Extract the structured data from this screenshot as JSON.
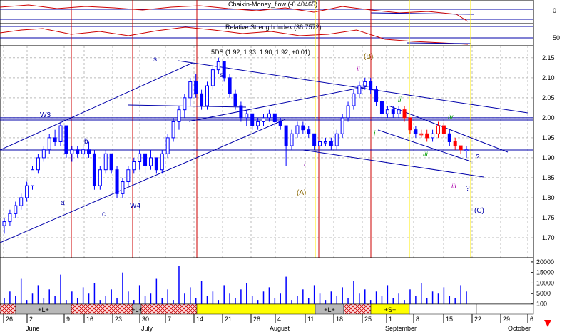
{
  "indicators": {
    "chaikin_label": "Chaikin-Money_flow (-0.40465)",
    "chaikin_scale": "0",
    "rsi_label": "Relative Strength Index (38.7572)",
    "rsi_scale": "50"
  },
  "price_header": "5DS (1.92, 1.93, 1.90, 1.92, +0.01)",
  "colors": {
    "bull": "#0000ff",
    "bear": "#ff0000",
    "trend": "#0000aa",
    "cycle_red": "#cc0000",
    "cycle_yellow": "#ffee00",
    "grid": "#bbbbbb"
  },
  "chart_data": {
    "type": "candlestick",
    "ylim": [
      1.65,
      2.18
    ],
    "price_ticks": [
      "2.15",
      "2.10",
      "2.05",
      "2.00",
      "1.95",
      "1.90",
      "1.85",
      "1.80",
      "1.75",
      "1.70"
    ],
    "volume_ticks": [
      "20000",
      "15000",
      "10000",
      "5000",
      "100"
    ],
    "date_ticks": [
      "26",
      "2",
      "9",
      "16",
      "23",
      "30",
      "7",
      "14",
      "21",
      "28",
      "4",
      "11",
      "18",
      "25",
      "1",
      "8",
      "15",
      "22",
      "29",
      "6"
    ],
    "month_labels": [
      "June",
      "July",
      "August",
      "September",
      "October"
    ],
    "cycle_segments": [
      {
        "label": "",
        "kind": "red"
      },
      {
        "label": "+L+",
        "kind": "grey"
      },
      {
        "label": "",
        "kind": "red"
      },
      {
        "label": "+L+",
        "kind": "grey"
      },
      {
        "label": "",
        "kind": "red"
      },
      {
        "label": "",
        "kind": "yellow"
      },
      {
        "label": "+L+",
        "kind": "grey"
      },
      {
        "label": "",
        "kind": "red"
      },
      {
        "label": "+S+",
        "kind": "yellow"
      },
      {
        "label": "",
        "kind": "white"
      }
    ],
    "wave_labels": [
      "W3",
      "b",
      "a",
      "c",
      "W4",
      "s",
      "s",
      "i",
      "(A)",
      "ii",
      "(B)",
      "i",
      "ii",
      "iii",
      "iv",
      "iii",
      "?",
      "?",
      "(C)"
    ],
    "candles": [
      [
        1.73,
        1.75,
        1.71,
        1.74
      ],
      [
        1.74,
        1.77,
        1.73,
        1.76
      ],
      [
        1.76,
        1.79,
        1.75,
        1.78
      ],
      [
        1.78,
        1.81,
        1.77,
        1.8
      ],
      [
        1.8,
        1.84,
        1.79,
        1.83
      ],
      [
        1.83,
        1.88,
        1.82,
        1.87
      ],
      [
        1.87,
        1.91,
        1.86,
        1.9
      ],
      [
        1.9,
        1.93,
        1.89,
        1.92
      ],
      [
        1.92,
        1.96,
        1.91,
        1.95
      ],
      [
        1.95,
        1.97,
        1.93,
        1.94
      ],
      [
        1.94,
        1.99,
        1.93,
        1.98
      ],
      [
        1.98,
        1.96,
        1.9,
        1.91
      ],
      [
        1.91,
        1.93,
        1.89,
        1.92
      ],
      [
        1.92,
        1.93,
        1.9,
        1.91
      ],
      [
        1.91,
        1.93,
        1.9,
        1.92
      ],
      [
        1.92,
        1.94,
        1.9,
        1.91
      ],
      [
        1.91,
        1.92,
        1.82,
        1.83
      ],
      [
        1.83,
        1.88,
        1.82,
        1.87
      ],
      [
        1.87,
        1.92,
        1.86,
        1.91
      ],
      [
        1.91,
        1.91,
        1.86,
        1.87
      ],
      [
        1.87,
        1.88,
        1.8,
        1.81
      ],
      [
        1.81,
        1.85,
        1.8,
        1.84
      ],
      [
        1.84,
        1.88,
        1.83,
        1.87
      ],
      [
        1.87,
        1.9,
        1.86,
        1.89
      ],
      [
        1.89,
        1.92,
        1.87,
        1.91
      ],
      [
        1.91,
        1.9,
        1.86,
        1.88
      ],
      [
        1.88,
        1.92,
        1.87,
        1.9
      ],
      [
        1.9,
        1.9,
        1.86,
        1.87
      ],
      [
        1.87,
        1.92,
        1.86,
        1.91
      ],
      [
        1.91,
        1.96,
        1.9,
        1.95
      ],
      [
        1.95,
        2.0,
        1.94,
        1.99
      ],
      [
        1.99,
        2.03,
        1.97,
        2.02
      ],
      [
        2.02,
        2.06,
        2.0,
        2.05
      ],
      [
        2.05,
        2.1,
        2.03,
        2.09
      ],
      [
        2.09,
        2.11,
        2.05,
        2.06
      ],
      [
        2.06,
        2.07,
        2.02,
        2.03
      ],
      [
        2.03,
        2.09,
        2.02,
        2.08
      ],
      [
        2.08,
        2.13,
        2.07,
        2.12
      ],
      [
        2.12,
        2.15,
        2.11,
        2.14
      ],
      [
        2.14,
        2.13,
        2.09,
        2.1
      ],
      [
        2.1,
        2.11,
        2.05,
        2.06
      ],
      [
        2.06,
        2.07,
        2.02,
        2.03
      ],
      [
        2.03,
        2.04,
        1.99,
        2.0
      ],
      [
        2.0,
        2.02,
        1.98,
        2.01
      ],
      [
        2.01,
        2.0,
        1.97,
        1.98
      ],
      [
        1.98,
        2.0,
        1.97,
        1.99
      ],
      [
        1.99,
        2.01,
        1.98,
        2.0
      ],
      [
        2.0,
        2.02,
        1.99,
        2.01
      ],
      [
        2.01,
        2.0,
        1.98,
        1.99
      ],
      [
        1.99,
        2.0,
        1.97,
        1.98
      ],
      [
        1.98,
        1.96,
        1.88,
        1.93
      ],
      [
        1.93,
        1.97,
        1.92,
        1.96
      ],
      [
        1.96,
        1.99,
        1.95,
        1.98
      ],
      [
        1.98,
        1.99,
        1.96,
        1.97
      ],
      [
        1.97,
        1.98,
        1.95,
        1.96
      ],
      [
        1.96,
        1.95,
        1.92,
        1.93
      ],
      [
        1.93,
        1.95,
        1.92,
        1.94
      ],
      [
        1.94,
        1.95,
        1.93,
        1.94
      ],
      [
        1.94,
        1.95,
        1.92,
        1.93
      ],
      [
        1.93,
        1.97,
        1.92,
        1.96
      ],
      [
        1.96,
        2.01,
        1.95,
        2.0
      ],
      [
        2.0,
        2.04,
        1.99,
        2.03
      ],
      [
        2.03,
        2.07,
        2.02,
        2.06
      ],
      [
        2.06,
        2.09,
        2.05,
        2.08
      ],
      [
        2.08,
        2.1,
        2.07,
        2.09
      ],
      [
        2.09,
        2.1,
        2.06,
        2.07
      ],
      [
        2.07,
        2.08,
        2.03,
        2.04
      ],
      [
        2.04,
        2.05,
        2.0,
        2.01
      ],
      [
        2.01,
        2.03,
        2.0,
        2.02
      ],
      [
        2.02,
        2.03,
        2.0,
        2.01
      ],
      [
        2.01,
        2.03,
        2.0,
        2.02
      ],
      [
        2.02,
        2.03,
        1.99,
        2.0
      ],
      [
        2.0,
        2.0,
        1.96,
        1.97
      ],
      [
        1.97,
        1.98,
        1.95,
        1.96
      ],
      [
        1.96,
        1.97,
        1.95,
        1.96
      ],
      [
        1.96,
        1.97,
        1.94,
        1.95
      ],
      [
        1.95,
        1.97,
        1.94,
        1.96
      ],
      [
        1.96,
        1.99,
        1.95,
        1.98
      ],
      [
        1.98,
        1.99,
        1.95,
        1.96
      ],
      [
        1.96,
        1.97,
        1.93,
        1.94
      ],
      [
        1.94,
        1.95,
        1.92,
        1.93
      ],
      [
        1.93,
        1.93,
        1.91,
        1.92
      ],
      [
        1.92,
        1.93,
        1.9,
        1.92
      ]
    ],
    "volumes": [
      3000,
      6000,
      4000,
      12000,
      2000,
      5000,
      9000,
      3000,
      7000,
      4000,
      14000,
      2000,
      6000,
      3000,
      8000,
      5000,
      10000,
      2000,
      4000,
      7000,
      3000,
      15000,
      6000,
      2000,
      9000,
      4000,
      5000,
      12000,
      3000,
      7000,
      2000,
      18000,
      5000,
      8000,
      3000,
      11000,
      4000,
      6000,
      2000,
      9000,
      5000,
      3000,
      7000,
      10000,
      4000,
      2000,
      6000,
      8000,
      3000,
      5000,
      13000,
      2000,
      4000,
      7000,
      3000,
      9000,
      5000,
      2000,
      6000,
      4000,
      8000,
      3000,
      11000,
      5000,
      7000,
      2000,
      6000,
      4000,
      9000,
      3000,
      5000,
      2000,
      7000,
      4000,
      10000,
      3000,
      6000,
      5000,
      8000,
      4000,
      3000,
      9000,
      6000
    ]
  }
}
